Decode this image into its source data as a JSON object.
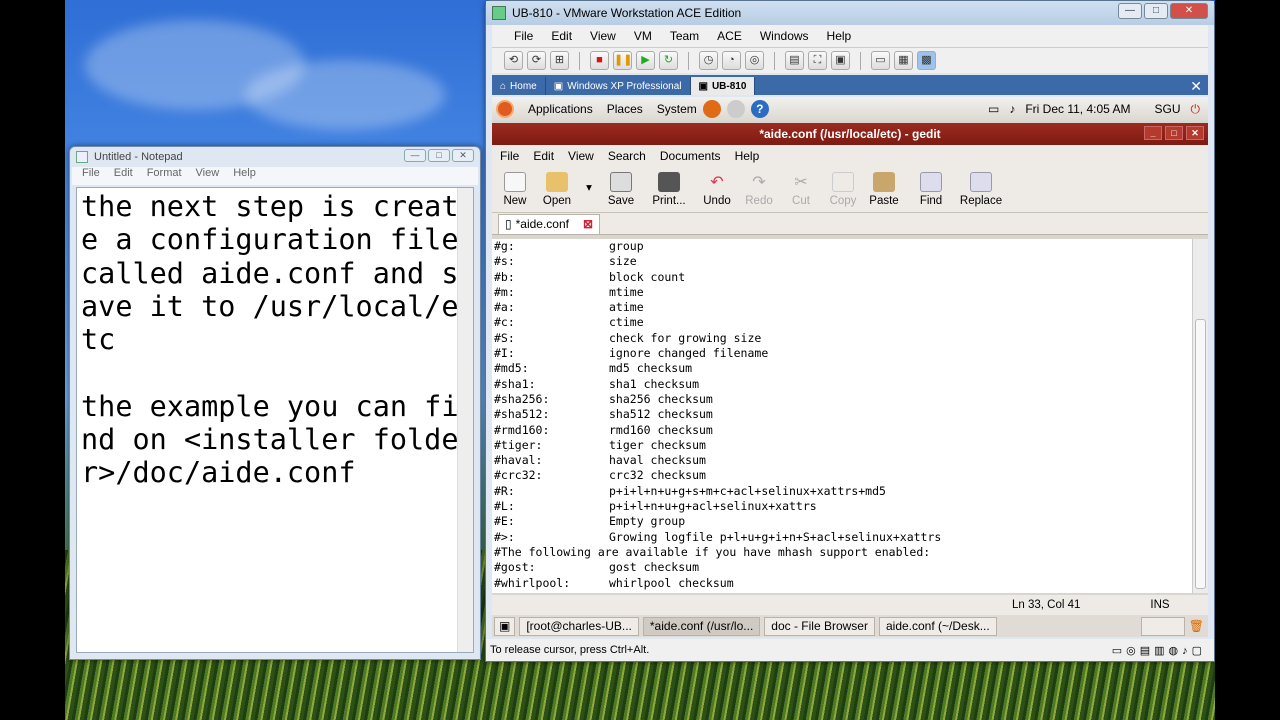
{
  "notepad": {
    "title": "Untitled - Notepad",
    "menu": [
      "File",
      "Edit",
      "Format",
      "View",
      "Help"
    ],
    "text": "the next step is create a configuration file called aide.conf and save it to /usr/local/etc\n\nthe example you can find on <installer folder>/doc/aide.conf"
  },
  "vmware": {
    "title": "UB-810 - VMware Workstation ACE Edition",
    "menu": [
      "File",
      "Edit",
      "View",
      "VM",
      "Team",
      "ACE",
      "Windows",
      "Help"
    ],
    "tabs": [
      "Home",
      "Windows XP Professional",
      "UB-810"
    ],
    "status": "To release cursor, press Ctrl+Alt."
  },
  "gnome": {
    "menus": [
      "Applications",
      "Places",
      "System"
    ],
    "clock": "Fri Dec 11,  4:05 AM",
    "user": "SGU"
  },
  "gedit": {
    "title": "*aide.conf (/usr/local/etc) - gedit",
    "menu": [
      "File",
      "Edit",
      "View",
      "Search",
      "Documents",
      "Help"
    ],
    "toolbar": [
      "New",
      "Open",
      "Save",
      "Print...",
      "Undo",
      "Redo",
      "Cut",
      "Copy",
      "Paste",
      "Find",
      "Replace"
    ],
    "doc_tab": "*aide.conf",
    "lines": [
      [
        "#g:",
        "group"
      ],
      [
        "#s:",
        "size"
      ],
      [
        "#b:",
        "block count"
      ],
      [
        "#m:",
        "mtime"
      ],
      [
        "#a:",
        "atime"
      ],
      [
        "#c:",
        "ctime"
      ],
      [
        "#S:",
        "check for growing size"
      ],
      [
        "#I:",
        "ignore changed filename"
      ],
      [
        "#md5:",
        "md5 checksum"
      ],
      [
        "#sha1:",
        "sha1 checksum"
      ],
      [
        "#sha256:",
        "sha256 checksum"
      ],
      [
        "#sha512:",
        "sha512 checksum"
      ],
      [
        "#rmd160:",
        "rmd160 checksum"
      ],
      [
        "#tiger:",
        "tiger checksum"
      ],
      [
        "#haval:",
        "haval checksum"
      ],
      [
        "#crc32:",
        "crc32 checksum"
      ],
      [
        "#R:",
        "p+i+l+n+u+g+s+m+c+acl+selinux+xattrs+md5"
      ],
      [
        "#L:",
        "p+i+l+n+u+g+acl+selinux+xattrs"
      ],
      [
        "#E:",
        "Empty group"
      ],
      [
        "#>:",
        "Growing logfile p+l+u+g+i+n+S+acl+selinux+xattrs"
      ],
      [
        "#The following are available if you have mhash support enabled:",
        ""
      ],
      [
        "#gost:",
        "gost checksum"
      ],
      [
        "#whirlpool:",
        "whirlpool checksum"
      ]
    ],
    "status_pos": "Ln 33, Col 41",
    "status_mode": "INS"
  },
  "taskbar": [
    "[root@charles-UB...",
    "*aide.conf (/usr/lo...",
    "doc - File Browser",
    "aide.conf (~/Desk..."
  ]
}
